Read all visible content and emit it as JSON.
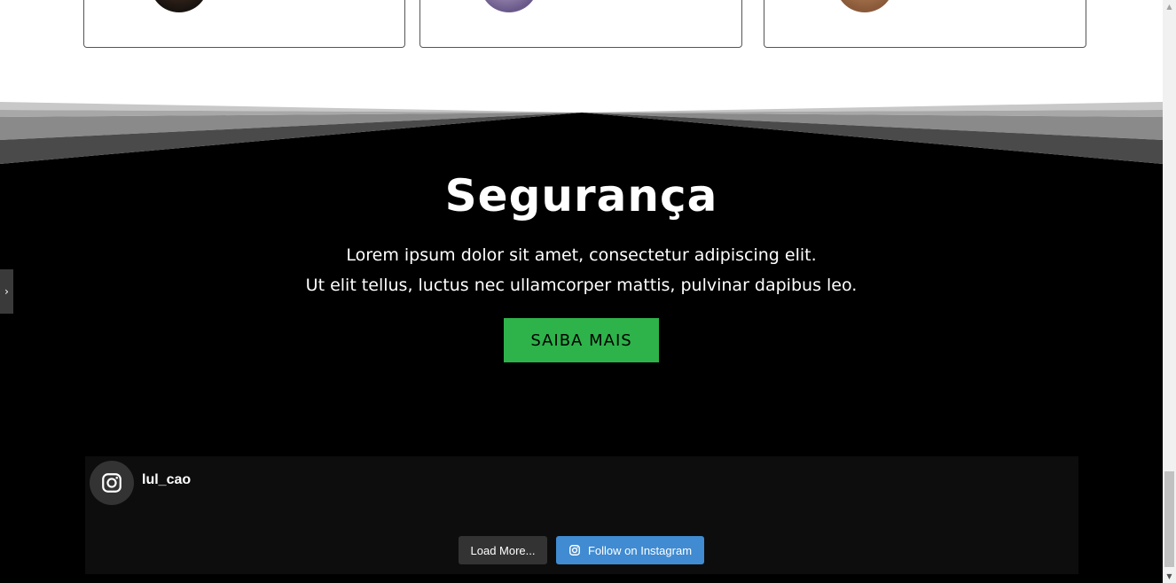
{
  "section": {
    "title": "Segurança",
    "description_line1": "Lorem ipsum dolor sit amet, consectetur adipiscing elit.",
    "description_line2": "Ut elit tellus, luctus nec ullamcorper mattis, pulvinar dapibus leo.",
    "cta_label": "SAIBA MAIS",
    "cta_color": "#2db34a"
  },
  "instagram": {
    "username": "lul_cao",
    "load_more_label": "Load More...",
    "follow_label": "Follow on Instagram",
    "icon": "instagram-icon",
    "follow_color": "#408bd1"
  },
  "side_toggle": {
    "icon": "chevron-right-icon"
  },
  "scrollbar": {
    "up_icon": "triangle-up-icon",
    "down_icon": "triangle-down-icon"
  }
}
